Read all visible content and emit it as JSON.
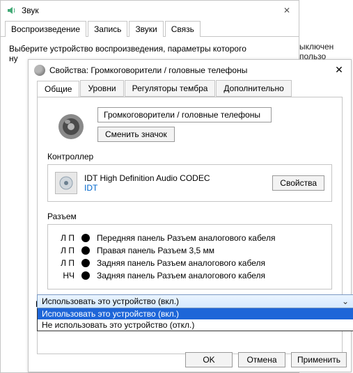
{
  "bg": {
    "title": "Звук",
    "tabs": [
      "Воспроизведение",
      "Запись",
      "Звуки",
      "Связь"
    ],
    "desc_line1": "Выберите устройство воспроизведения, параметры которого",
    "desc_line2": "ну",
    "right_text": "ыключен пользо"
  },
  "fg": {
    "title": "Свойства: Громкоговорители / головные телефоны",
    "tabs": {
      "general": "Общие",
      "levels": "Уровни",
      "enhance": "Регуляторы тембра",
      "extra": "Дополнительно"
    },
    "device_name": "Громкоговорители / головные телефоны",
    "change_icon": "Сменить значок",
    "controller_label": "Контроллер",
    "controller_name": "IDT High Definition Audio CODEC",
    "controller_link": "IDT",
    "properties_btn": "Свойства",
    "jack_label": "Разъем",
    "jacks": [
      {
        "ch": "Л П",
        "desc": "Передняя панель Разъем аналогового кабеля"
      },
      {
        "ch": "Л П",
        "desc": "Правая панель Разъем 3,5 мм"
      },
      {
        "ch": "Л П",
        "desc": "Задняя панель Разъем аналогового кабеля"
      },
      {
        "ch": "НЧ",
        "desc": "Задняя панель Разъем аналогового кабеля"
      }
    ],
    "usage_label": "Применение устройства:",
    "usage_selected": "Использовать это устройство (вкл.)",
    "usage_options": [
      "Использовать это устройство (вкл.)",
      "Не использовать это устройство (откл.)"
    ],
    "ok": "OK",
    "cancel": "Отмена",
    "apply": "Применить"
  }
}
